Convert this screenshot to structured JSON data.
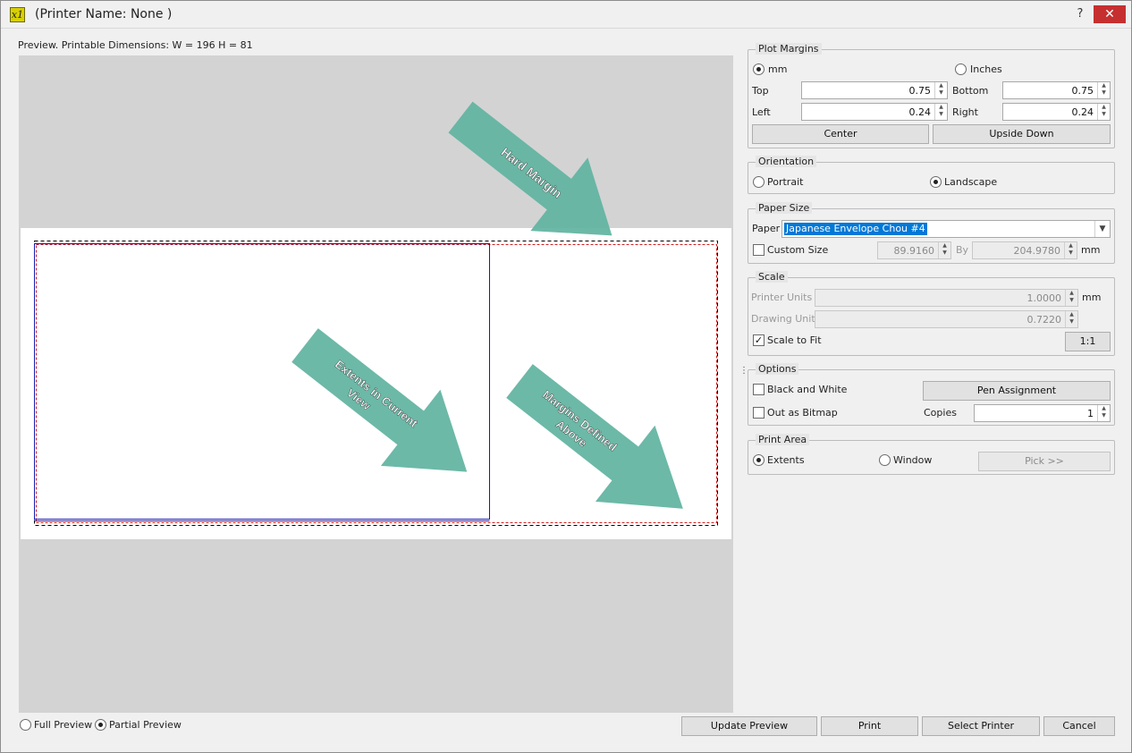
{
  "window": {
    "title": "(Printer Name: None )",
    "help_label": "?",
    "close_label": "✕",
    "icon_glyph": "x1"
  },
  "preview": {
    "label": "Preview. Printable Dimensions: W = 196 H = 81",
    "annotations": {
      "hard_margin": "Hard Margin",
      "extents_line1": "Extents in Current",
      "extents_line2": "View",
      "margins_line1": "Margins Defined",
      "margins_line2": "Above"
    },
    "arrow_color": "#5fb3a1"
  },
  "plot_margins": {
    "title": "Plot Margins",
    "unit_mm": "mm",
    "unit_inches": "Inches",
    "selected_unit": "mm",
    "top_label": "Top",
    "top_value": "0.75",
    "bottom_label": "Bottom",
    "bottom_value": "0.75",
    "left_label": "Left",
    "left_value": "0.24",
    "right_label": "Right",
    "right_value": "0.24",
    "center_button": "Center",
    "upside_down_button": "Upside Down"
  },
  "orientation": {
    "title": "Orientation",
    "portrait": "Portrait",
    "landscape": "Landscape",
    "selected": "Landscape"
  },
  "paper_size": {
    "title": "Paper Size",
    "paper_label": "Paper",
    "paper_value": "Japanese Envelope Chou #4",
    "custom_size_label": "Custom Size",
    "custom_checked": false,
    "width_value": "89.9160",
    "by_label": "By",
    "height_value": "204.9780",
    "unit": "mm"
  },
  "scale": {
    "title": "Scale",
    "printer_units_label": "Printer Units",
    "printer_units_value": "1.0000",
    "printer_unit_suffix": "mm",
    "drawing_units_label": "Drawing Units",
    "drawing_units_value": "0.7220",
    "scale_to_fit_label": "Scale to Fit",
    "scale_to_fit_checked": true,
    "ratio_button": "1:1"
  },
  "options": {
    "title": "Options",
    "black_white_label": "Black and White",
    "black_white_checked": false,
    "pen_assignment_button": "Pen Assignment",
    "out_as_bitmap_label": "Out as Bitmap",
    "out_as_bitmap_checked": false,
    "copies_label": "Copies",
    "copies_value": "1"
  },
  "print_area": {
    "title": "Print Area",
    "extents": "Extents",
    "window": "Window",
    "selected": "Extents",
    "pick_button": "Pick >>"
  },
  "footer": {
    "full_preview": "Full Preview",
    "partial_preview": "Partial Preview",
    "selected_preview": "Partial Preview",
    "update_preview_button": "Update Preview",
    "print_button": "Print",
    "select_printer_button": "Select Printer",
    "cancel_button": "Cancel"
  }
}
